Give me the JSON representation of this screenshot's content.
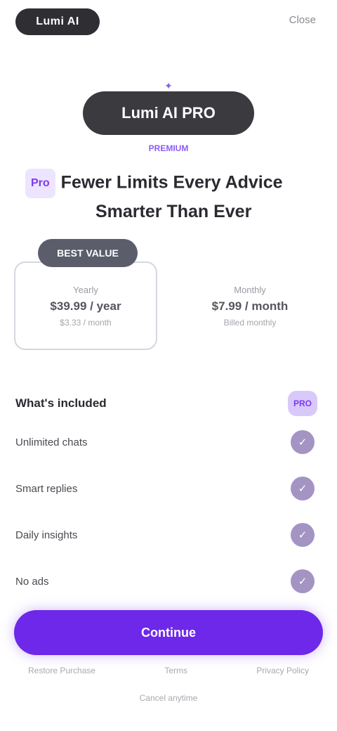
{
  "topbar": {
    "logo_label": "Lumi AI",
    "close_label": "Close"
  },
  "hero": {
    "pill_label": "Lumi AI PRO",
    "caption": "PREMIUM",
    "sparkle_icon": "sparkle-icon"
  },
  "headline": {
    "tag": "Pro",
    "line1": "Fewer Limits Every Advice",
    "line2": "Smarter Than Ever"
  },
  "plans": {
    "badge": "BEST VALUE",
    "yearly": {
      "name": "Yearly",
      "price": "$39.99 / year",
      "sub": "$3.33 / month"
    },
    "monthly": {
      "name": "Monthly",
      "price": "$7.99 / month",
      "sub": "Billed monthly"
    }
  },
  "features": {
    "title": "What's included",
    "chip": "PRO",
    "items": [
      {
        "label": "Unlimited chats"
      },
      {
        "label": "Smart replies"
      },
      {
        "label": "Daily insights"
      },
      {
        "label": "No ads"
      }
    ]
  },
  "cta": {
    "label": "Continue"
  },
  "footer": {
    "left": "Restore Purchase",
    "center": "Terms",
    "right": "Privacy Policy",
    "note": "Cancel anytime"
  },
  "colors": {
    "accent": "#6d28e9",
    "accent_light": "#d9c9fb",
    "check": "#a394c4",
    "dark_pill": "#3a3a3f"
  }
}
